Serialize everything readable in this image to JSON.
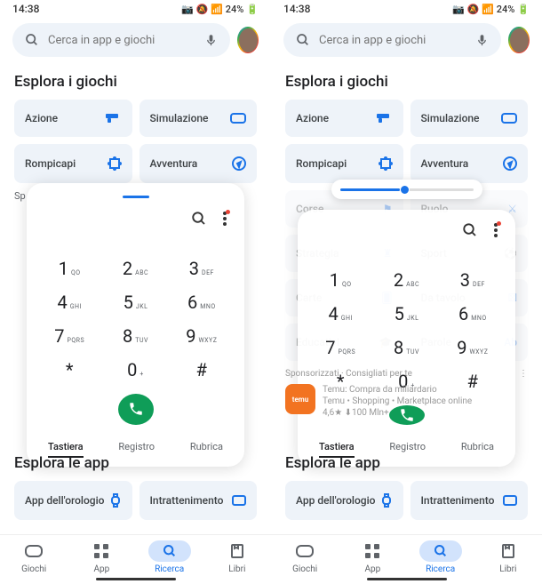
{
  "status": {
    "time": "14:38",
    "battery": "24%"
  },
  "search": {
    "placeholder": "Cerca in app e giochi"
  },
  "section1": "Esplora i giochi",
  "section2": "Esplora le app",
  "chips": {
    "r1": [
      {
        "l": "Azione"
      },
      {
        "l": "Simulazione"
      }
    ],
    "r2": [
      {
        "l": "Rompicapi"
      },
      {
        "l": "Avventura"
      }
    ],
    "r3": [
      {
        "l": "Corse"
      },
      {
        "l": "Ruolo"
      }
    ],
    "r4": [
      {
        "l": "Strategia"
      },
      {
        "l": "Sport"
      }
    ],
    "r5": [
      {
        "l": "Carte"
      },
      {
        "l": "Da tavolo"
      }
    ],
    "r6": [
      {
        "l": "Educativi"
      },
      {
        "l": "Parole"
      }
    ],
    "apps": [
      {
        "l": "App dell'orologio"
      },
      {
        "l": "Intrattenimento"
      }
    ]
  },
  "dialer": {
    "keys": [
      {
        "d": "1",
        "l": "QO"
      },
      {
        "d": "2",
        "l": "ABC"
      },
      {
        "d": "3",
        "l": "DEF"
      },
      {
        "d": "4",
        "l": "GHI"
      },
      {
        "d": "5",
        "l": "JKL"
      },
      {
        "d": "6",
        "l": "MNO"
      },
      {
        "d": "7",
        "l": "PQRS"
      },
      {
        "d": "8",
        "l": "TUV"
      },
      {
        "d": "9",
        "l": "WXYZ"
      },
      {
        "d": "*",
        "l": ""
      },
      {
        "d": "0",
        "l": "+"
      },
      {
        "d": "#",
        "l": ""
      }
    ],
    "tabs": {
      "keypad": "Tastiera",
      "log": "Registro",
      "contacts": "Rubrica"
    }
  },
  "spons": {
    "label": "Sponsorizzati · Consigliati per te",
    "app_title": "Temu: Compra da miliardario",
    "app_sub": "Temu • Shopping • Marketplace online",
    "app_meta": "4,6★ ⬇100 Mln+"
  },
  "nav": {
    "giochi": "Giochi",
    "app": "App",
    "ricerca": "Ricerca",
    "libri": "Libri"
  },
  "sp": "Sp"
}
